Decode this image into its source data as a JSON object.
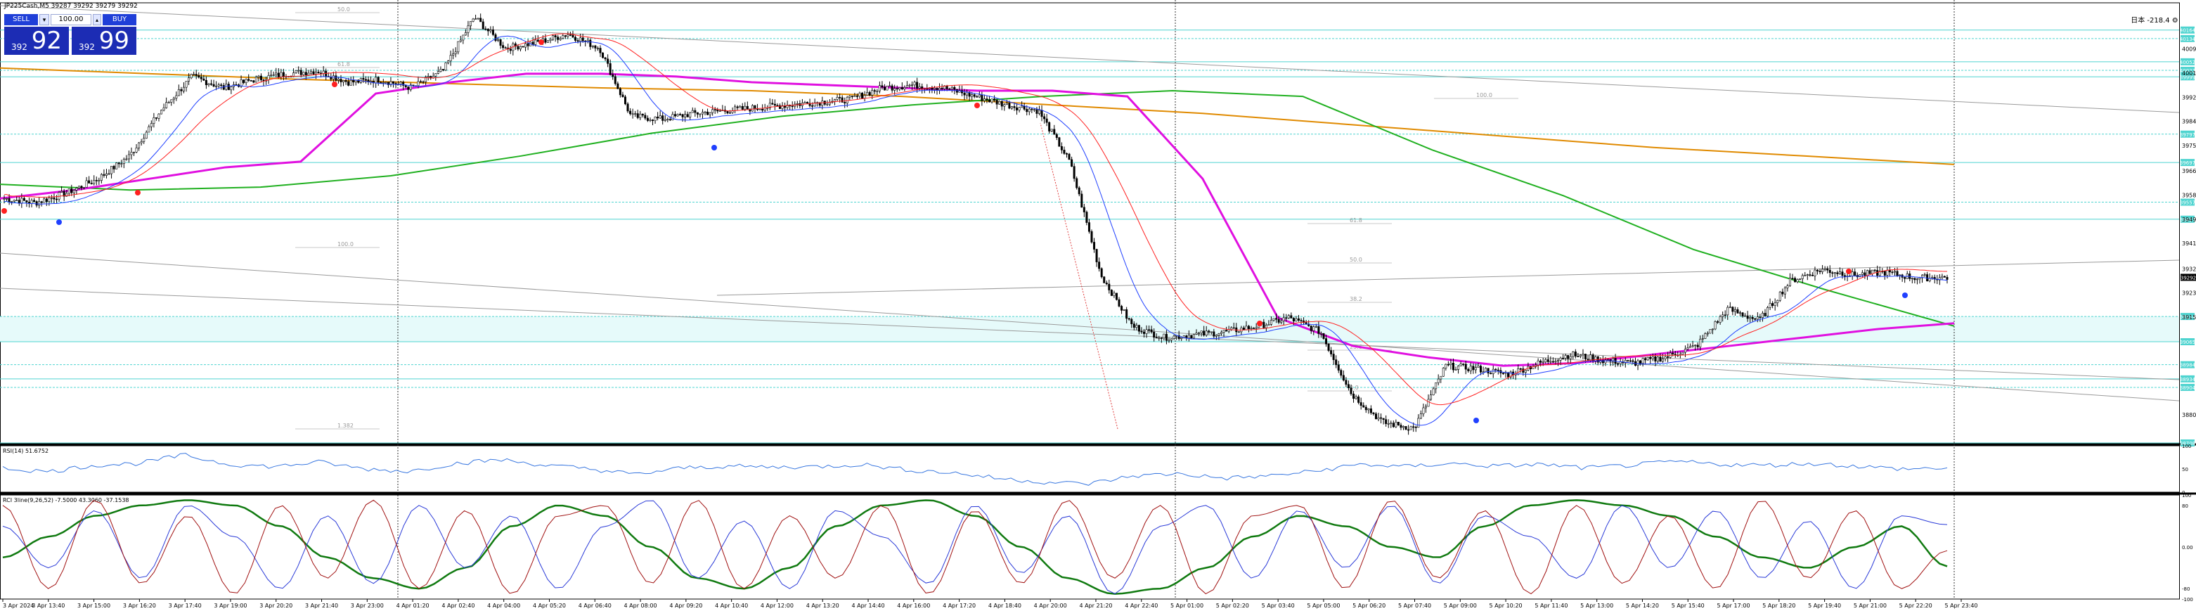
{
  "window": {
    "symbol_title": "JP225Cash,M5  39287 39292 39279 39292",
    "top_right_text": "日本 -218.4 ⚙"
  },
  "trade_panel": {
    "sell_label": "SELL",
    "buy_label": "BUY",
    "lot_value": "100.00",
    "sell_price_small": "392",
    "sell_price_big": "92",
    "buy_price_small": "392",
    "buy_price_big": "99"
  },
  "colors": {
    "candle": "#000000",
    "ma_magenta": "#e010e0",
    "ma_green": "#20b020",
    "ma_orange": "#e08a00",
    "ma_blue": "#2040ff",
    "ma_red": "#ff2020",
    "grid_cyan": "#4fd4d0",
    "zone_fill": "#e6fafa",
    "rsi_line": "#3a78e0",
    "rci_green": "#107a10",
    "rci_blue": "#2a3ad8",
    "rci_red": "#a01010",
    "price_label_bg": "#4fd4d0",
    "current_price_bg": "#000000"
  },
  "chart_data": [
    {
      "type": "candlestick",
      "name": "main",
      "price_axis_labels": [
        "40097",
        "40012",
        "39927",
        "39842",
        "39757",
        "39667",
        "39582",
        "39497",
        "39412",
        "39322",
        "39237",
        "39152",
        "38807"
      ],
      "current_price_label": "39292",
      "level_tag_labels": [
        "40164",
        "40134",
        "40052",
        "40022",
        "39999",
        "39797",
        "39697",
        "39557",
        "39497",
        "39154",
        "39065",
        "38984",
        "38934",
        "38904",
        "38708"
      ],
      "ylim": [
        38708,
        40260
      ],
      "fib_labels": [
        "50.0",
        "61.8",
        "100.0",
        "100.0",
        "61.8",
        "50.0",
        "38.2",
        "23.6",
        "0.0",
        "1.382"
      ],
      "time_labels": [
        "3 Apr 2024",
        "3 Apr 13:40",
        "3 Apr 15:00",
        "3 Apr 16:20",
        "3 Apr 17:40",
        "3 Apr 19:00",
        "3 Apr 20:20",
        "3 Apr 21:40",
        "3 Apr 23:00",
        "4 Apr 01:20",
        "4 Apr 02:40",
        "4 Apr 04:00",
        "4 Apr 05:20",
        "4 Apr 06:40",
        "4 Apr 08:00",
        "4 Apr 09:20",
        "4 Apr 10:40",
        "4 Apr 12:00",
        "4 Apr 13:20",
        "4 Apr 14:40",
        "4 Apr 16:00",
        "4 Apr 17:20",
        "4 Apr 18:40",
        "4 Apr 20:00",
        "4 Apr 21:20",
        "4 Apr 22:40",
        "5 Apr 01:00",
        "5 Apr 02:20",
        "5 Apr 03:40",
        "5 Apr 05:00",
        "5 Apr 06:20",
        "5 Apr 07:40",
        "5 Apr 09:00",
        "5 Apr 10:20",
        "5 Apr 11:40",
        "5 Apr 13:00",
        "5 Apr 14:20",
        "5 Apr 15:40",
        "5 Apr 17:00",
        "5 Apr 18:20",
        "5 Apr 19:40",
        "5 Apr 21:00",
        "5 Apr 22:20",
        "5 Apr 23:40"
      ],
      "price_path": [
        39570,
        39555,
        39590,
        39640,
        39720,
        39880,
        40000,
        39960,
        39990,
        40010,
        40020,
        39980,
        39990,
        39960,
        40020,
        40210,
        40100,
        40120,
        40150,
        40100,
        39860,
        39850,
        39870,
        39880,
        39890,
        39900,
        39910,
        39920,
        39960,
        39970,
        39960,
        39930,
        39900,
        39880,
        39700,
        39300,
        39120,
        39080,
        39090,
        39100,
        39120,
        39150,
        39100,
        38880,
        38780,
        38760,
        38980,
        38970,
        38950,
        38990,
        39020,
        39000,
        38990,
        39010,
        39050,
        39180,
        39140,
        39280,
        39320,
        39300,
        39310,
        39290,
        39292
      ],
      "ma_magenta": [
        39570,
        39600,
        39640,
        39680,
        39700,
        39940,
        39980,
        40010,
        40010,
        40000,
        39980,
        39970,
        39960,
        39950,
        39950,
        39930,
        39640,
        39150,
        39050,
        39010,
        38980,
        38990,
        39020,
        39050,
        39080,
        39110,
        39130
      ],
      "ma_green": [
        39620,
        39600,
        39610,
        39650,
        39720,
        39800,
        39860,
        39900,
        39930,
        39950,
        39930,
        39740,
        39580,
        39390,
        39250,
        39120
      ],
      "ma_orange": [
        40030,
        40010,
        39990,
        39975,
        39960,
        39950,
        39930,
        39900,
        39870,
        39830,
        39790,
        39750,
        39720,
        39690
      ]
    },
    {
      "type": "line",
      "name": "rsi",
      "title": "RSI(14) 51.6752",
      "axis_labels": [
        "100",
        "50",
        "0"
      ],
      "ylim": [
        0,
        100
      ],
      "values": [
        52,
        44,
        58,
        62,
        80,
        60,
        55,
        65,
        50,
        45,
        62,
        70,
        58,
        50,
        38,
        52,
        56,
        54,
        55,
        60,
        48,
        42,
        30,
        22,
        18,
        35,
        40,
        30,
        35,
        45,
        60,
        55,
        62,
        56,
        60,
        52,
        58,
        66,
        60,
        58,
        62,
        56,
        50,
        52
      ]
    },
    {
      "type": "line",
      "name": "rci",
      "title": "RCI 3line(9,26,52) -7.5000 43.3060 -37.1538",
      "axis_labels": [
        "100",
        "80",
        "0.00",
        "-80",
        "-100"
      ],
      "ylim": [
        -100,
        100
      ],
      "series": [
        {
          "values": [
            -20,
            20,
            60,
            80,
            90,
            80,
            40,
            -20,
            -60,
            -80,
            -40,
            40,
            80,
            60,
            0,
            -60,
            -80,
            -40,
            40,
            80,
            90,
            60,
            0,
            -60,
            -90,
            -80,
            -40,
            20,
            60,
            40,
            0,
            -20,
            40,
            80,
            90,
            80,
            60,
            20,
            -20,
            -40,
            0,
            40,
            -37
          ]
        },
        {
          "values": [
            40,
            -40,
            70,
            -60,
            80,
            20,
            -80,
            60,
            -70,
            80,
            -40,
            60,
            -80,
            40,
            90,
            -60,
            50,
            -80,
            70,
            20,
            -70,
            80,
            -50,
            60,
            -90,
            40,
            80,
            -60,
            70,
            -40,
            80,
            -70,
            60,
            20,
            -60,
            80,
            -40,
            70,
            -60,
            50,
            -80,
            60,
            43
          ]
        },
        {
          "values": [
            80,
            -80,
            90,
            -70,
            60,
            -90,
            80,
            -60,
            90,
            -80,
            70,
            -90,
            60,
            80,
            -70,
            90,
            -80,
            60,
            -60,
            80,
            -90,
            70,
            -70,
            90,
            -60,
            80,
            -90,
            60,
            80,
            -80,
            90,
            -60,
            70,
            -90,
            80,
            -70,
            60,
            -80,
            90,
            -60,
            70,
            -80,
            -7
          ]
        }
      ]
    }
  ]
}
